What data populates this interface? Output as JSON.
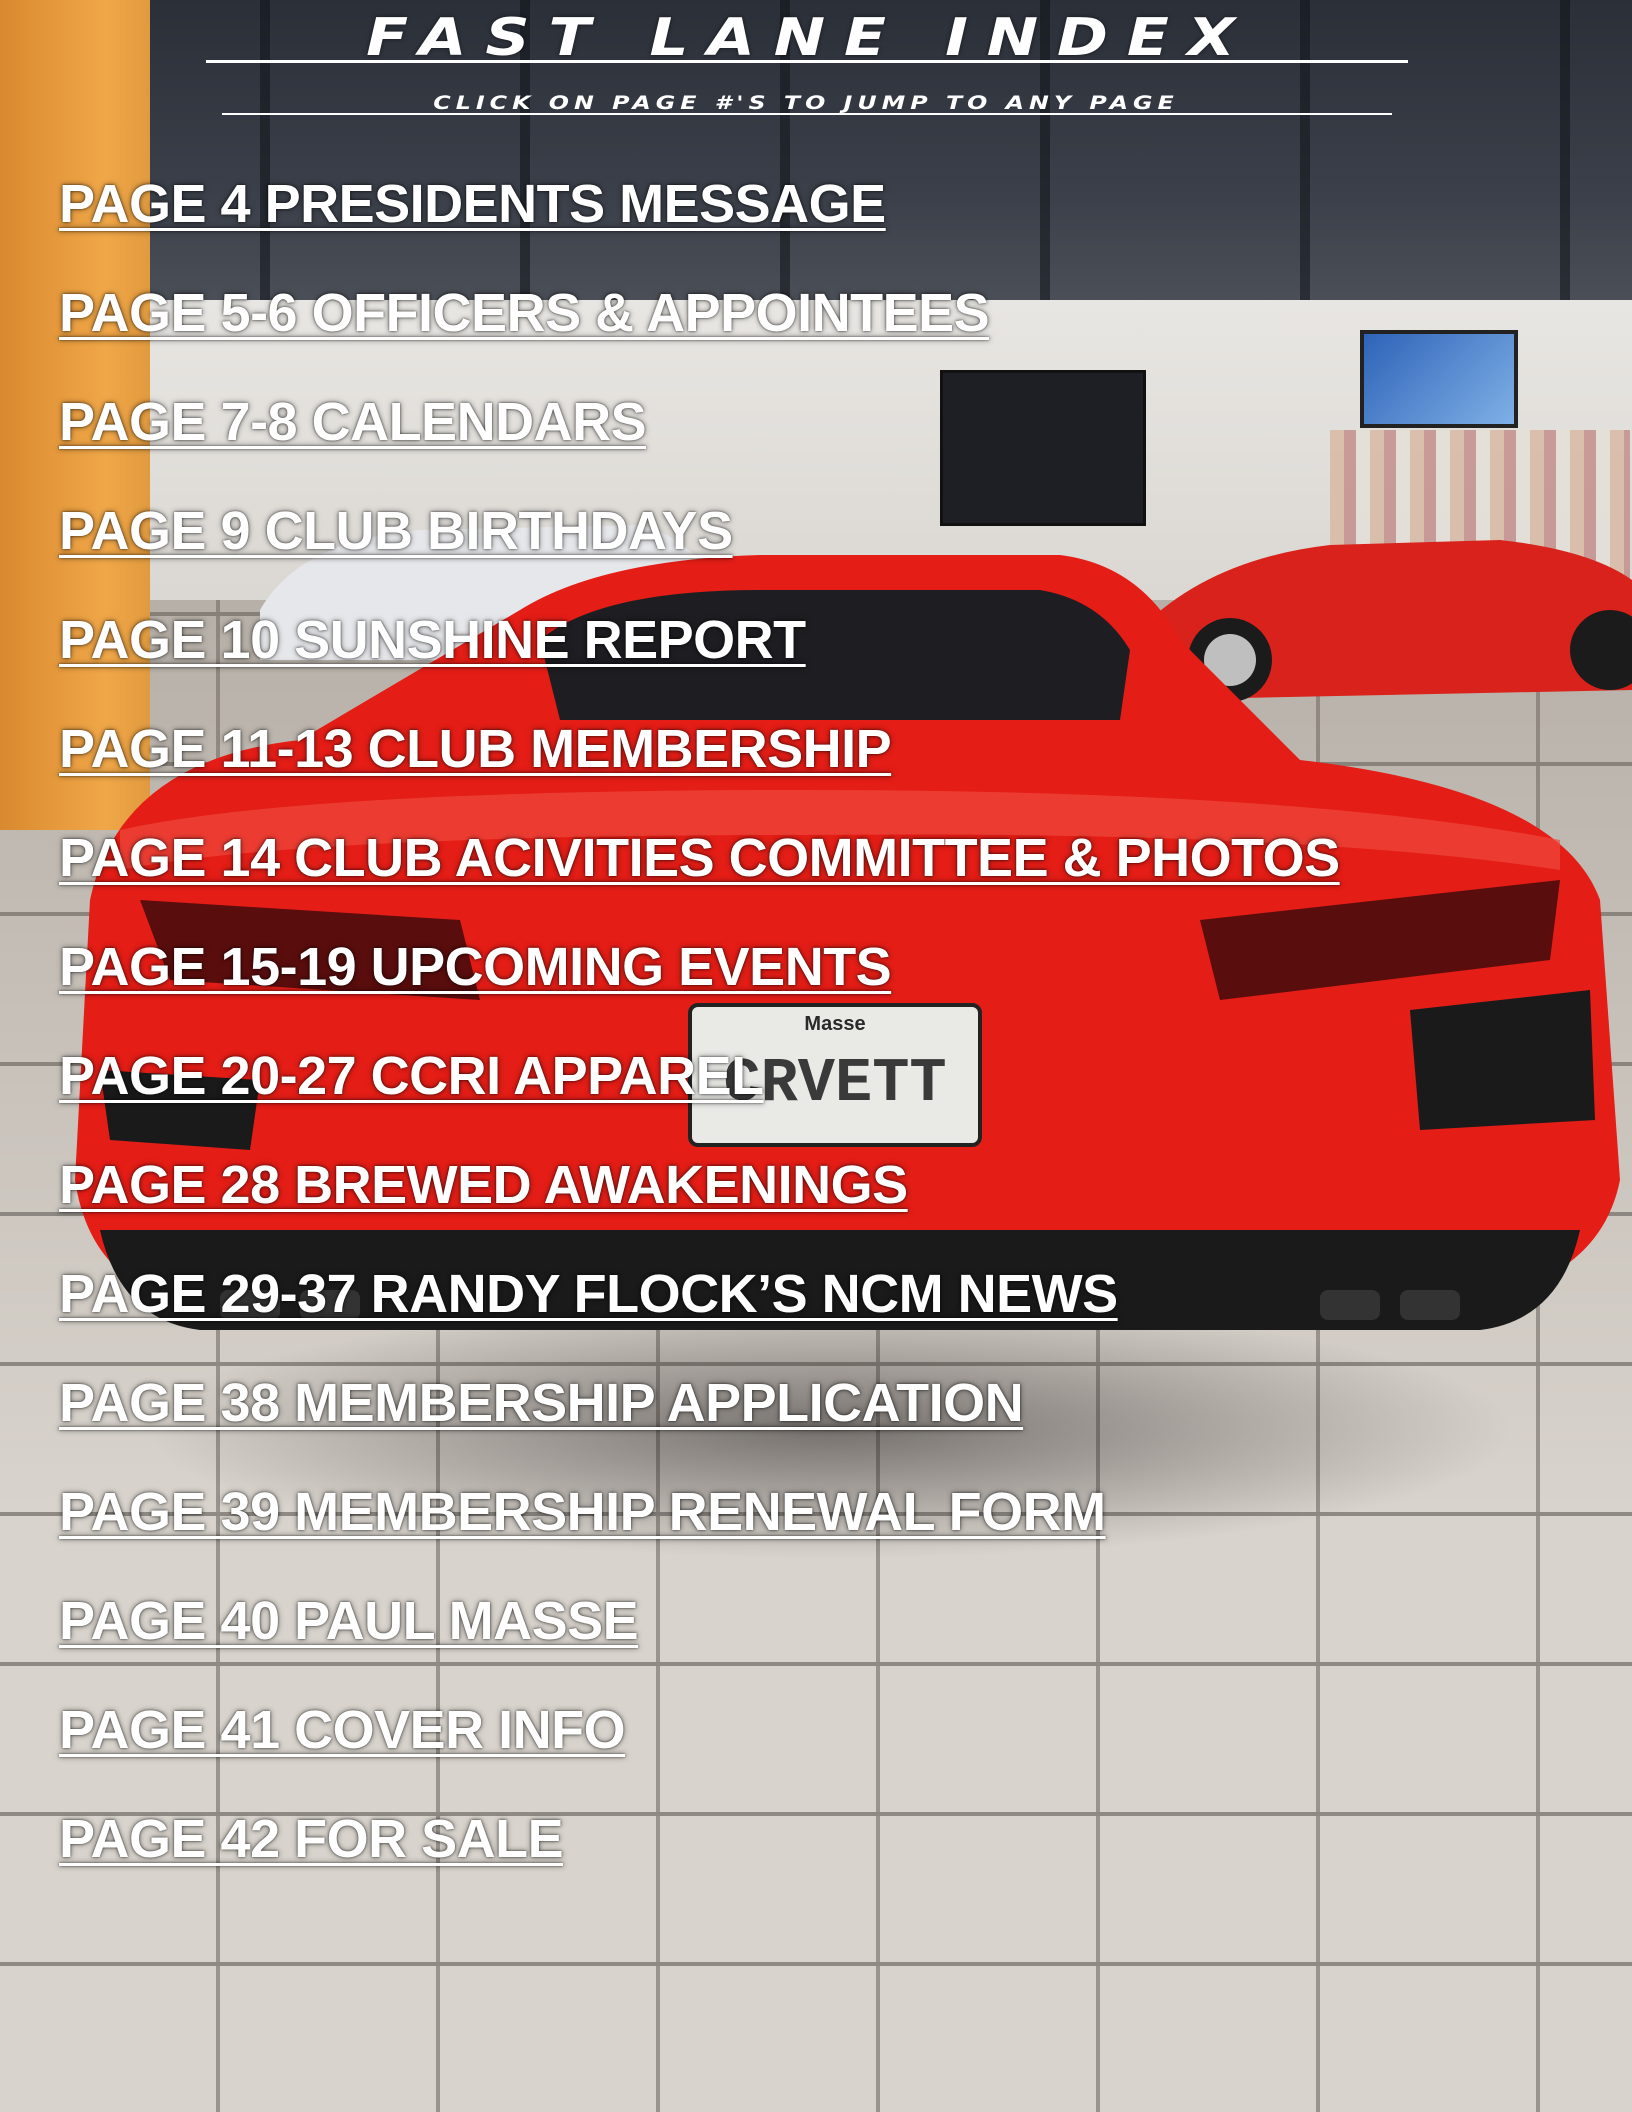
{
  "header": {
    "title": "FAST LANE INDEX",
    "subtitle": "CLICK ON PAGE #'S TO JUMP TO ANY PAGE"
  },
  "background": {
    "description_icon": "photo-of-red-car",
    "plate_text": "CRVETT",
    "plate_brand": "Masse",
    "colors": {
      "car_red": "#e41d16",
      "pillar_orange": "#f0a748",
      "text": "#ffffff"
    }
  },
  "index": [
    {
      "label": "PAGE 4 PRESIDENTS MESSAGE"
    },
    {
      "label": "PAGE 5-6 OFFICERS & APPOINTEES"
    },
    {
      "label": "PAGE 7-8 CALENDARS"
    },
    {
      "label": "PAGE 9 CLUB BIRTHDAYS"
    },
    {
      "label": "PAGE 10 SUNSHINE REPORT"
    },
    {
      "label": "PAGE 11-13 CLUB MEMBERSHIP"
    },
    {
      "label": "PAGE 14 CLUB ACIVITIES COMMITTEE & PHOTOS"
    },
    {
      "label": "PAGE 15-19 UPCOMING EVENTS"
    },
    {
      "label": "PAGE 20-27 CCRI APPAREL"
    },
    {
      "label": "PAGE 28 BREWED AWAKENINGS"
    },
    {
      "label": "PAGE 29-37 RANDY FLOCK’S NCM NEWS"
    },
    {
      "label": "PAGE 38 MEMBERSHIP APPLICATION"
    },
    {
      "label": "PAGE 39 MEMBERSHIP RENEWAL FORM"
    },
    {
      "label": "PAGE 40 PAUL MASSE"
    },
    {
      "label": "PAGE 41 COVER INFO"
    },
    {
      "label": "PAGE 42 FOR SALE"
    }
  ]
}
